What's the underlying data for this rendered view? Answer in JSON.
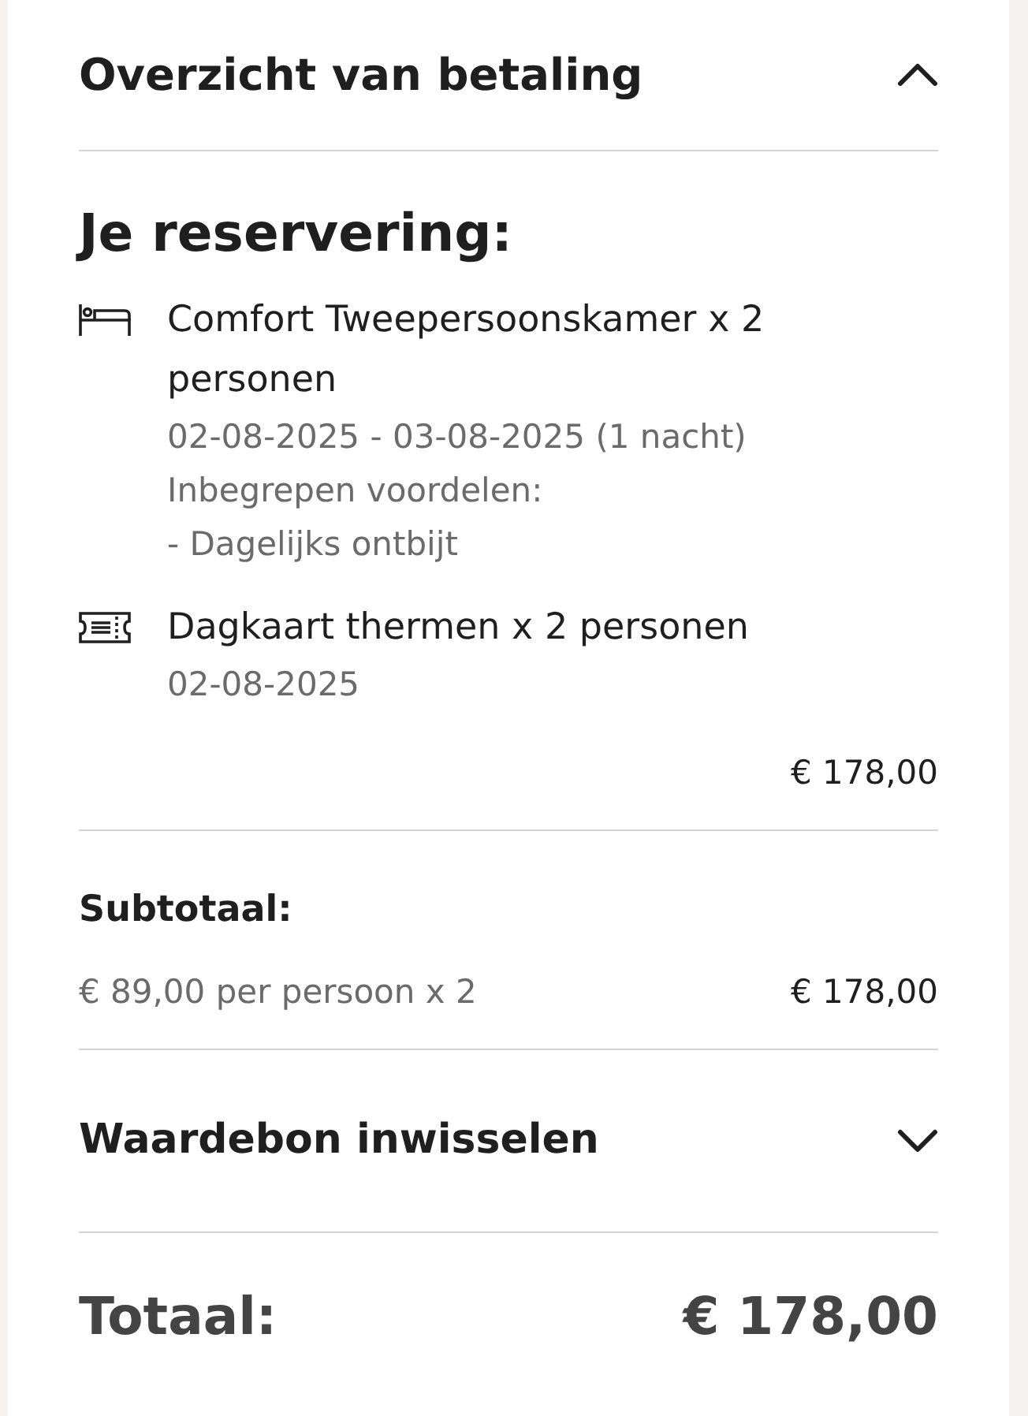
{
  "header": {
    "title": "Overzicht van betaling",
    "expanded": true
  },
  "reservation": {
    "heading": "Je reservering:",
    "items": [
      {
        "kind": "room",
        "title": "Comfort Tweepersoonskamer x 2 personen",
        "details": [
          "02-08-2025 - 03-08-2025 (1 nacht)",
          "Inbegrepen voordelen:",
          "- Dagelijks ontbijt"
        ]
      },
      {
        "kind": "ticket",
        "title": "Dagkaart thermen x 2 personen",
        "details": [
          "02-08-2025"
        ]
      }
    ],
    "amount": "€ 178,00"
  },
  "subtotal": {
    "label": "Subtotaal:",
    "description": "€ 89,00 per persoon x 2",
    "amount": "€ 178,00"
  },
  "voucher": {
    "title": "Waardebon inwisselen",
    "expanded": false
  },
  "total": {
    "label": "Totaal:",
    "amount": "€ 178,00"
  }
}
